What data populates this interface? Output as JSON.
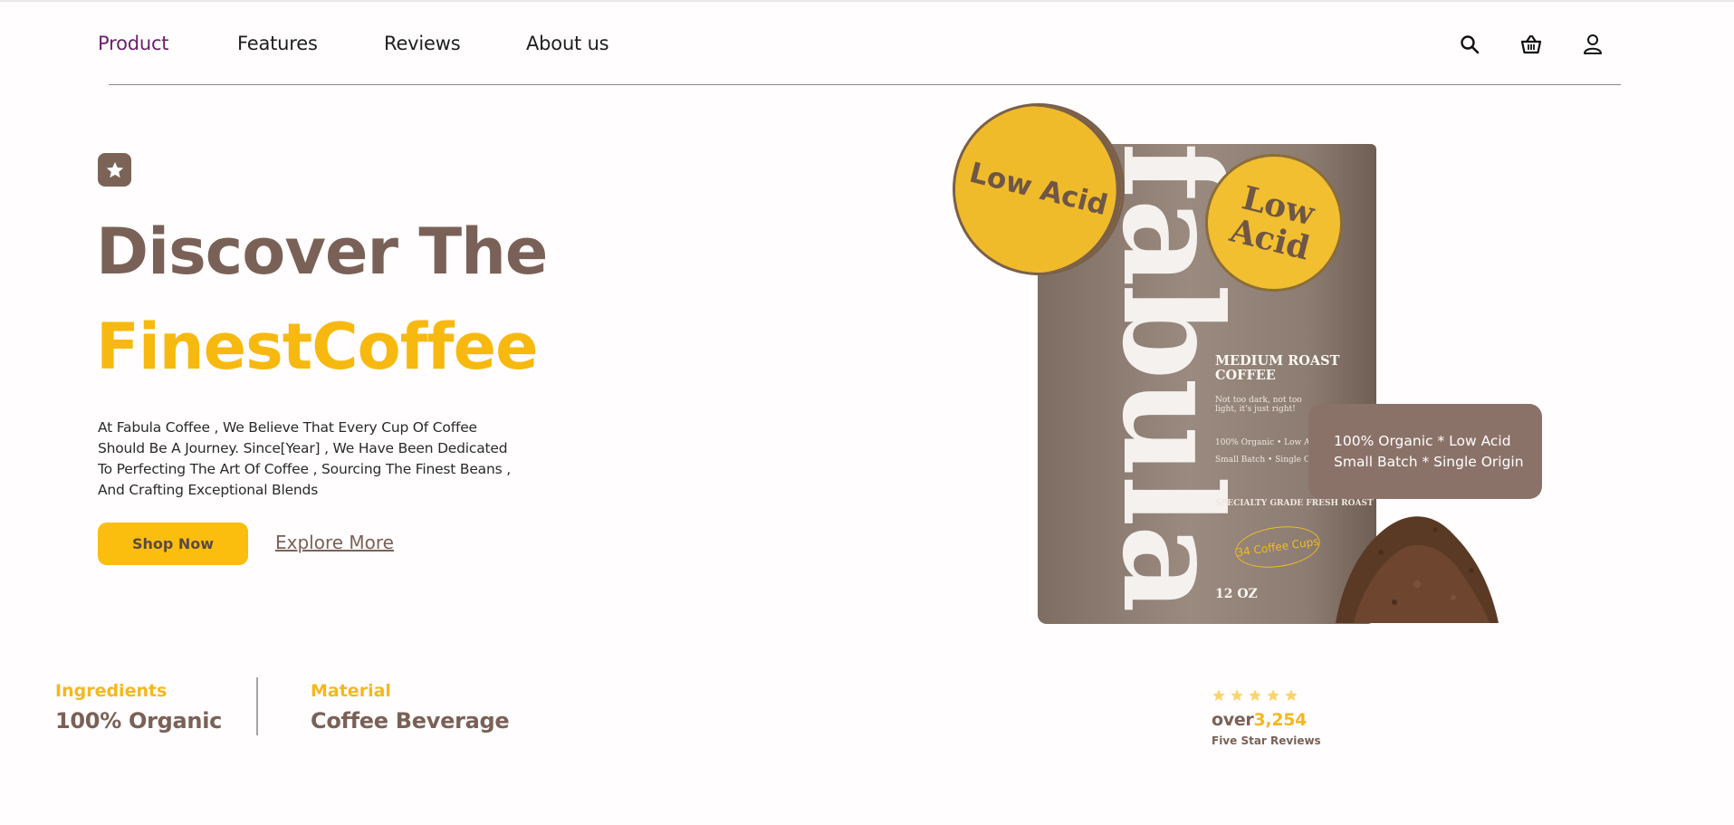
{
  "nav": {
    "links": [
      "Product",
      "Features",
      "Reviews",
      "About us"
    ],
    "active": "Product",
    "icons": [
      "search-icon",
      "basket-icon",
      "user-icon"
    ]
  },
  "hero": {
    "badge_icon": "star-icon",
    "headline_line1": "Discover The",
    "headline_line2": "FinestCoffee",
    "description": "At Fabula Coffee , We Believe That Every Cup Of Coffee Should Be A Journey. Since[Year] , We Have Been Dedicated To Perfecting The Art Of Coffee , Sourcing The Finest Beans , And Crafting Exceptional Blends",
    "primary_button": "Shop Now",
    "secondary_link": "Explore More"
  },
  "product": {
    "brand": "fabula",
    "seal_front": "Low Acid",
    "seal_bag": "Low Acid",
    "bag_title": "MEDIUM ROAST COFFEE",
    "bag_tagline": "Not too dark, not too light, it's just right!",
    "bag_features_1": "100% Organic • Low Acid",
    "bag_features_2": "Small Batch • Single Origin",
    "bag_grade": "SPECIALTY GRADE FRESH ROAST",
    "bag_cups": "34 Coffee Cups",
    "bag_weight": "12 OZ",
    "tooltip_line1": "100% Organic * Low Acid",
    "tooltip_line2": "Small Batch * Single Origin"
  },
  "stats": {
    "ingredients_label": "Ingredients",
    "ingredients_value": "100% Organic",
    "material_label": "Material",
    "material_value": "Coffee Beverage",
    "rating_stars": 5,
    "reviews_prefix": "over",
    "reviews_count": "3,254",
    "reviews_caption": "Five Star Reviews"
  },
  "colors": {
    "accent": "#f7b90f",
    "brown": "#7a6157",
    "active_nav": "#6b1f6b",
    "tooltip_bg": "#8b7269"
  }
}
